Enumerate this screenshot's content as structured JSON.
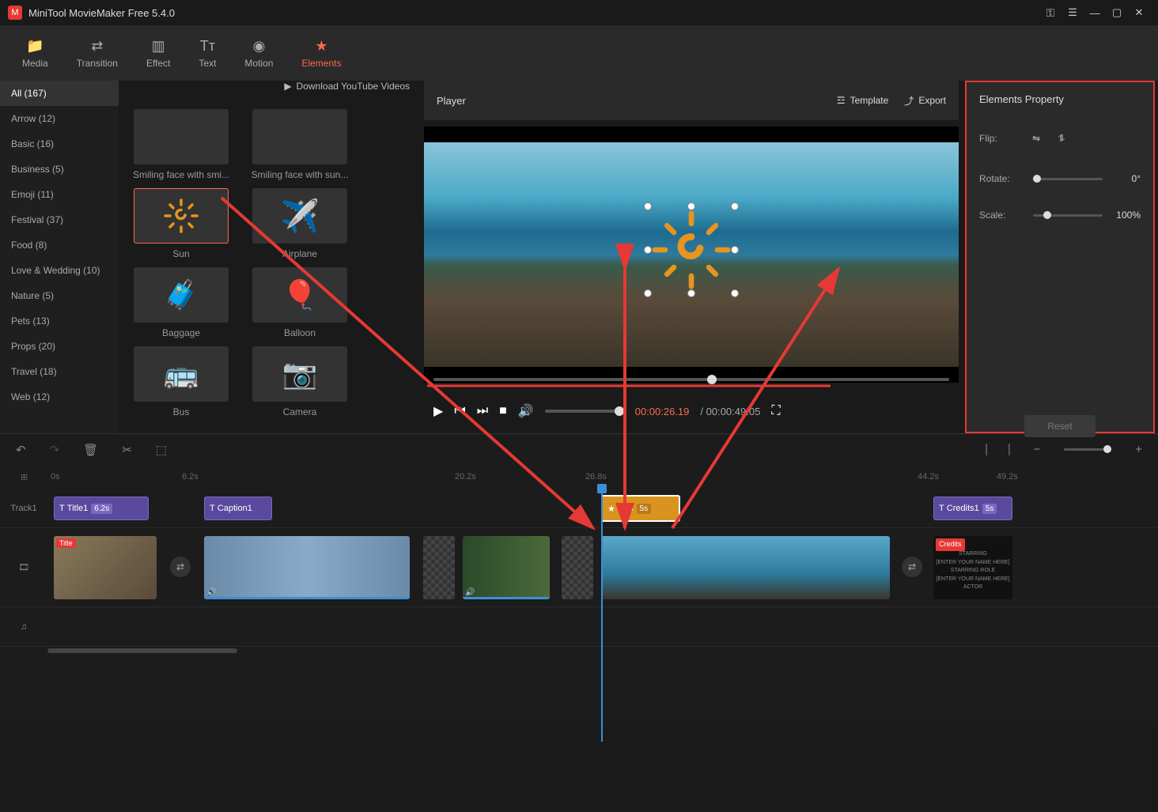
{
  "app": {
    "title": "MiniTool MovieMaker Free 5.4.0"
  },
  "tabs": [
    {
      "label": "Media",
      "icon": "📁"
    },
    {
      "label": "Transition",
      "icon": "⇄"
    },
    {
      "label": "Effect",
      "icon": "▥"
    },
    {
      "label": "Text",
      "icon": "Tᴛ"
    },
    {
      "label": "Motion",
      "icon": "◉"
    },
    {
      "label": "Elements",
      "icon": "★"
    }
  ],
  "dlyt": "Download YouTube Videos",
  "categories": [
    {
      "label": "All (167)",
      "sel": true
    },
    {
      "label": "Arrow (12)"
    },
    {
      "label": "Basic (16)"
    },
    {
      "label": "Business (5)"
    },
    {
      "label": "Emoji (11)"
    },
    {
      "label": "Festival (37)"
    },
    {
      "label": "Food (8)"
    },
    {
      "label": "Love & Wedding (10)"
    },
    {
      "label": "Nature (5)"
    },
    {
      "label": "Pets (13)"
    },
    {
      "label": "Props (20)"
    },
    {
      "label": "Travel (18)"
    },
    {
      "label": "Web (12)"
    }
  ],
  "elements": [
    [
      {
        "label": "Smiling face with smi..."
      },
      {
        "label": "Smiling face with sun..."
      }
    ],
    [
      {
        "label": "Sun",
        "sel": true
      },
      {
        "label": "Airplane"
      }
    ],
    [
      {
        "label": "Baggage"
      },
      {
        "label": "Balloon"
      }
    ],
    [
      {
        "label": "Bus"
      },
      {
        "label": "Camera"
      }
    ]
  ],
  "player": {
    "title": "Player",
    "template": "Template",
    "export": "Export"
  },
  "playback": {
    "current": "00:00:26.19",
    "total": "/ 00:00:49.05"
  },
  "props": {
    "title": "Elements Property",
    "flip": "Flip:",
    "rotate": "Rotate:",
    "rotate_val": "0°",
    "scale": "Scale:",
    "scale_val": "100%",
    "reset": "Reset"
  },
  "ruler": [
    "0s",
    "6.2s",
    "20.2s",
    "26.8s",
    "44.2s",
    "49.2s"
  ],
  "track1": "Track1",
  "clips": {
    "title1": {
      "label": "Title1",
      "dur": "6.2s"
    },
    "caption1": {
      "label": "Caption1"
    },
    "sun": {
      "label": "Sun",
      "dur": "5s"
    },
    "credits1": {
      "label": "Credits1",
      "dur": "5s"
    },
    "title_tag": "Title",
    "credits_tag": "Credits",
    "credits_text1": "STARRING",
    "credits_text2": "[ENTER YOUR NAME HERE]",
    "credits_text3": "STARRING ROLE",
    "credits_text4": "[ENTER YOUR NAME HERE]",
    "credits_text5": "ACTOR"
  }
}
